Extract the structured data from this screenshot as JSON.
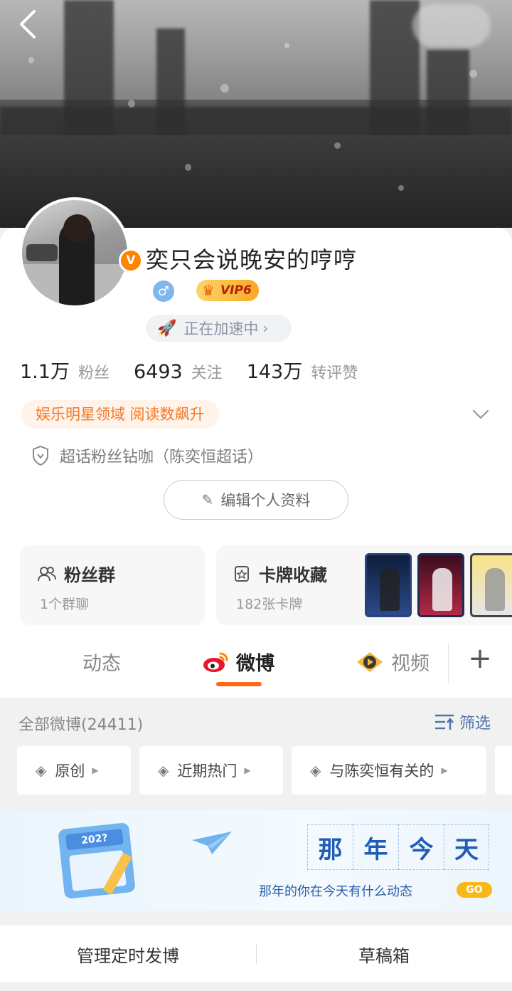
{
  "profile": {
    "name": "奕只会说晚安的哼哼",
    "verified_badge": "V",
    "gender_symbol": "♂",
    "vip_label": "VIP6",
    "speed_label": "正在加速中",
    "stats": [
      {
        "value": "1.1万",
        "label": "粉丝"
      },
      {
        "value": "6493",
        "label": "关注"
      },
      {
        "value": "143万",
        "label": "转评赞"
      }
    ],
    "hot_tag": "娱乐明星领域 阅读数飙升",
    "supertopic": "超话粉丝钻咖（陈奕恒超话）",
    "edit_label": "编辑个人资料"
  },
  "boxes": {
    "fan_group": {
      "title": "粉丝群",
      "sub": "1个群聊"
    },
    "card_collect": {
      "title": "卡牌收藏",
      "sub": "182张卡牌"
    }
  },
  "tabs": [
    {
      "label": "动态"
    },
    {
      "label": "微博"
    },
    {
      "label": "视频"
    }
  ],
  "feed": {
    "all_count": "全部微博(24411)",
    "filter_label": "筛选",
    "chips": [
      {
        "label": "原创"
      },
      {
        "label": "近期热门"
      },
      {
        "label": "与陈奕恒有关的"
      }
    ]
  },
  "banner": {
    "title_chars": [
      "那",
      "年",
      "今",
      "天"
    ],
    "subtitle": "那年的你在今天有什么动态",
    "go_label": "GO",
    "calendar_year": "202?"
  },
  "bottom": {
    "manage_label": "管理定时发博",
    "drafts_label": "草稿箱"
  },
  "colors": {
    "accent": "#ff6a1a",
    "verified": "#ff8200",
    "link_blue": "#5073a8",
    "hot_tag_text": "#f27a2c"
  },
  "icons": [
    "back-arrow-icon",
    "rocket-icon",
    "chevron-right-icon",
    "chevron-down-icon",
    "shield-icon",
    "pencil-icon",
    "people-icon",
    "card-icon",
    "weibo-logo-icon",
    "video-icon",
    "plus-icon",
    "filter-icon",
    "layers-icon",
    "paper-plane-icon",
    "calendar-icon"
  ]
}
